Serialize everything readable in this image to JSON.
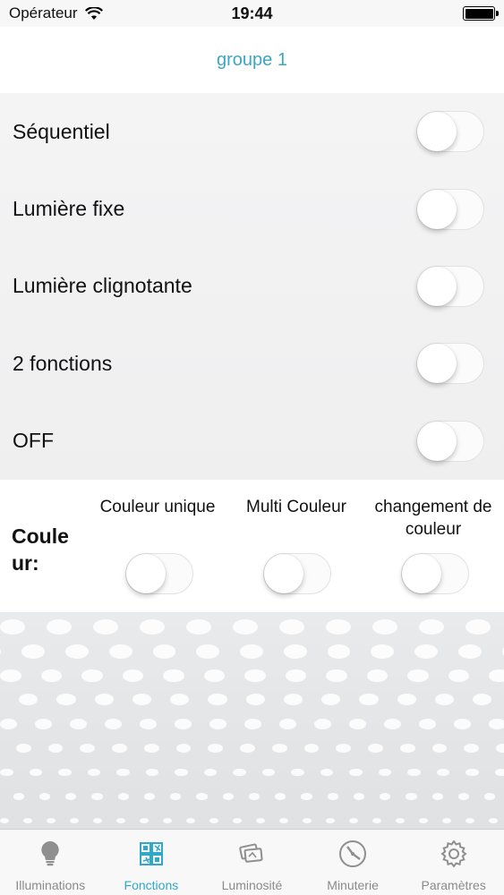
{
  "status_bar": {
    "carrier": "Opérateur",
    "time": "19:44"
  },
  "header": {
    "title": "groupe 1"
  },
  "functions": [
    {
      "label": "Séquentiel",
      "on": false
    },
    {
      "label": "Lumière fixe",
      "on": false
    },
    {
      "label": "Lumière clignotante",
      "on": false
    },
    {
      "label": "2 fonctions",
      "on": false
    },
    {
      "label": "OFF",
      "on": false
    }
  ],
  "color": {
    "title": "Couleur:",
    "title_line1": "Coule",
    "title_line2": "ur:",
    "options": [
      {
        "line1": "Couleur unique",
        "line2": "",
        "on": false
      },
      {
        "line1": "Multi Couleur",
        "line2": "",
        "on": false
      },
      {
        "line1": "changement de",
        "line2": "couleur",
        "on": false
      }
    ]
  },
  "tabs": [
    {
      "label": "Illuminations",
      "icon": "lightbulb-icon",
      "active": false
    },
    {
      "label": "Fonctions",
      "icon": "functions-grid-icon",
      "active": true
    },
    {
      "label": "Luminosité",
      "icon": "brightness-cards-icon",
      "active": false
    },
    {
      "label": "Minuterie",
      "icon": "timer-clock-icon",
      "active": false
    },
    {
      "label": "Paramètres",
      "icon": "gear-icon",
      "active": false
    }
  ],
  "colors": {
    "accent": "#3BA7C2",
    "inactive_tab": "#8A8A8A"
  }
}
